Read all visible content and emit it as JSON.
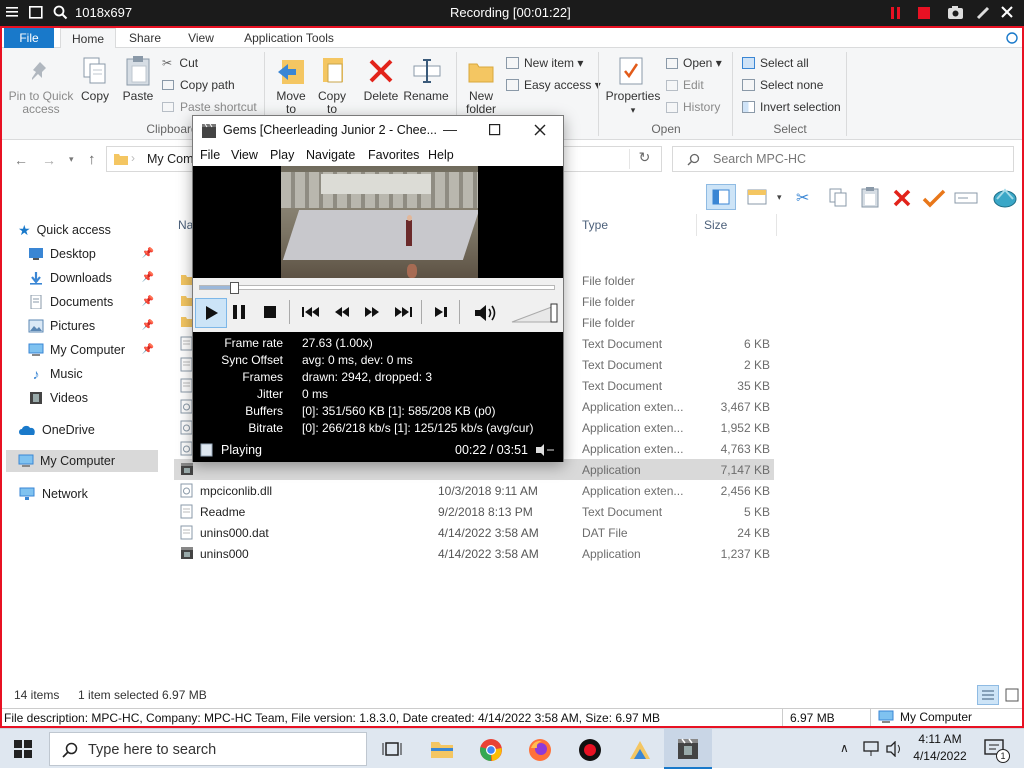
{
  "recording": {
    "size": "1018x697",
    "title": "Recording [00:01:22]"
  },
  "ribbon": {
    "tabs": [
      "File",
      "Home",
      "Share",
      "View",
      "Application Tools"
    ],
    "pin_label": "Pin to Quick access",
    "copy": "Copy",
    "paste": "Paste",
    "cut": "Cut",
    "copy_path": "Copy path",
    "paste_shortcut": "Paste shortcut",
    "clipboard": "Clipboard",
    "move_to": "Move to",
    "copy_to": "Copy to",
    "delete": "Delete",
    "rename": "Rename",
    "new_folder": "New folder",
    "new_item": "New item",
    "easy_access": "Easy access",
    "properties": "Properties",
    "open": "Open",
    "edit": "Edit",
    "history": "History",
    "open_group": "Open",
    "select_all": "Select all",
    "select_none": "Select none",
    "invert_selection": "Invert selection",
    "select_group": "Select"
  },
  "address": {
    "path": "My Com",
    "search_placeholder": "Search MPC-HC"
  },
  "nav": {
    "quick_access": "Quick access",
    "items": [
      "Desktop",
      "Downloads",
      "Documents",
      "Pictures",
      "My Computer",
      "Music",
      "Videos"
    ],
    "onedrive": "OneDrive",
    "my_computer": "My Computer",
    "network": "Network"
  },
  "columns": {
    "name": "Na",
    "type": "Type",
    "size": "Size"
  },
  "files": [
    {
      "name": "",
      "date": "",
      "type": "File folder",
      "size": ""
    },
    {
      "name": "",
      "date": "",
      "type": "File folder",
      "size": ""
    },
    {
      "name": "",
      "date": "",
      "type": "File folder",
      "size": ""
    },
    {
      "name": "",
      "date": "",
      "type": "Text Document",
      "size": "6 KB"
    },
    {
      "name": "",
      "date": "",
      "type": "Text Document",
      "size": "2 KB"
    },
    {
      "name": "",
      "date": "",
      "type": "Text Document",
      "size": "35 KB"
    },
    {
      "name": "",
      "date": "",
      "type": "Application exten...",
      "size": "3,467 KB"
    },
    {
      "name": "",
      "date": "",
      "type": "Application exten...",
      "size": "1,952 KB"
    },
    {
      "name": "",
      "date": "",
      "type": "Application exten...",
      "size": "4,763 KB"
    },
    {
      "name": "",
      "date": "",
      "type": "Application",
      "size": "7,147 KB"
    },
    {
      "name": "mpciconlib.dll",
      "date": "10/3/2018 9:11 AM",
      "type": "Application exten...",
      "size": "2,456 KB"
    },
    {
      "name": "Readme",
      "date": "9/2/2018 8:13 PM",
      "type": "Text Document",
      "size": "5 KB"
    },
    {
      "name": "unins000.dat",
      "date": "4/14/2022 3:58 AM",
      "type": "DAT File",
      "size": "24 KB"
    },
    {
      "name": "unins000",
      "date": "4/14/2022 3:58 AM",
      "type": "Application",
      "size": "1,237 KB"
    }
  ],
  "status": {
    "items": "14 items",
    "selected": "1 item selected  6.97 MB"
  },
  "descbar": {
    "text": "File description: MPC-HC, Company: MPC-HC Team, File version: 1.8.3.0, Date created: 4/14/2022 3:58 AM, Size: 6.97 MB",
    "size": "6.97 MB",
    "computer": "My Computer"
  },
  "mpc": {
    "title": "Gems  [Cheerleading Junior 2 - Chee...",
    "menu": [
      "File",
      "View",
      "Play",
      "Navigate",
      "Favorites",
      "Help"
    ],
    "seek_fraction": 0.1,
    "stats": [
      {
        "label": "Frame rate",
        "value": "27.63 (1.00x)"
      },
      {
        "label": "Sync Offset",
        "value": "avg: 0 ms, dev: 0 ms"
      },
      {
        "label": "Frames",
        "value": "drawn: 2942, dropped: 3"
      },
      {
        "label": "Jitter",
        "value": "0 ms"
      },
      {
        "label": "Buffers",
        "value": "[0]: 351/560 KB [1]: 585/208 KB (p0)"
      },
      {
        "label": "Bitrate",
        "value": "[0]: 266/218 kb/s [1]: 125/125 kb/s (avg/cur)"
      }
    ],
    "state": "Playing",
    "time": "00:22 / 03:51"
  },
  "taskbar": {
    "search_placeholder": "Type here to search",
    "time": "4:11 AM",
    "date": "4/14/2022",
    "notif_count": "1"
  },
  "colors": {
    "accent": "#1979ca",
    "rec_red": "#e81123",
    "selection": "#d9d9d9"
  }
}
